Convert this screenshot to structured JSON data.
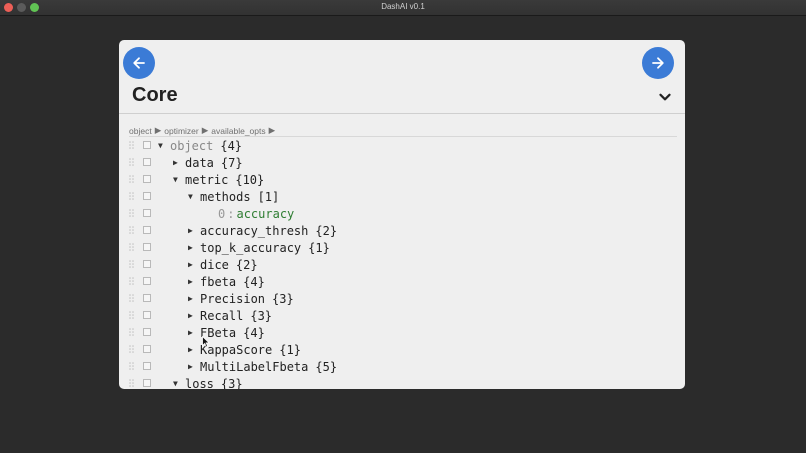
{
  "window": {
    "title": "DashAI v0.1"
  },
  "header": {
    "title": "Core"
  },
  "breadcrumb": [
    "object",
    "optimizer",
    "available_opts"
  ],
  "tree": [
    {
      "key": "object",
      "count": "{4}",
      "expanded": true,
      "level": 0,
      "root": true
    },
    {
      "key": "data",
      "count": "{7}",
      "expanded": false,
      "level": 1
    },
    {
      "key": "metric",
      "count": "{10}",
      "expanded": true,
      "level": 1
    },
    {
      "key": "methods",
      "count": "[1]",
      "expanded": true,
      "level": 2
    },
    {
      "index": "0",
      "value": "accuracy",
      "level": 3
    },
    {
      "key": "accuracy_thresh",
      "count": "{2}",
      "expanded": false,
      "level": 2
    },
    {
      "key": "top_k_accuracy",
      "count": "{1}",
      "expanded": false,
      "level": 2
    },
    {
      "key": "dice",
      "count": "{2}",
      "expanded": false,
      "level": 2
    },
    {
      "key": "fbeta",
      "count": "{4}",
      "expanded": false,
      "level": 2
    },
    {
      "key": "Precision",
      "count": "{3}",
      "expanded": false,
      "level": 2
    },
    {
      "key": "Recall",
      "count": "{3}",
      "expanded": false,
      "level": 2
    },
    {
      "key": "FBeta",
      "count": "{4}",
      "expanded": false,
      "level": 2
    },
    {
      "key": "KappaScore",
      "count": "{1}",
      "expanded": false,
      "level": 2
    },
    {
      "key": "MultiLabelFbeta",
      "count": "{5}",
      "expanded": false,
      "level": 2
    },
    {
      "key": "loss",
      "count": "{3}",
      "expanded": true,
      "level": 1
    }
  ],
  "icons": {
    "back": "arrow-left-icon",
    "forward": "arrow-right-icon",
    "dropdown": "chevron-down-icon",
    "drag": "drag-handle-icon"
  },
  "colors": {
    "accent": "#3b7bd6",
    "value": "#2e7d32",
    "panel": "#efefef",
    "background": "#2b2b2b"
  }
}
